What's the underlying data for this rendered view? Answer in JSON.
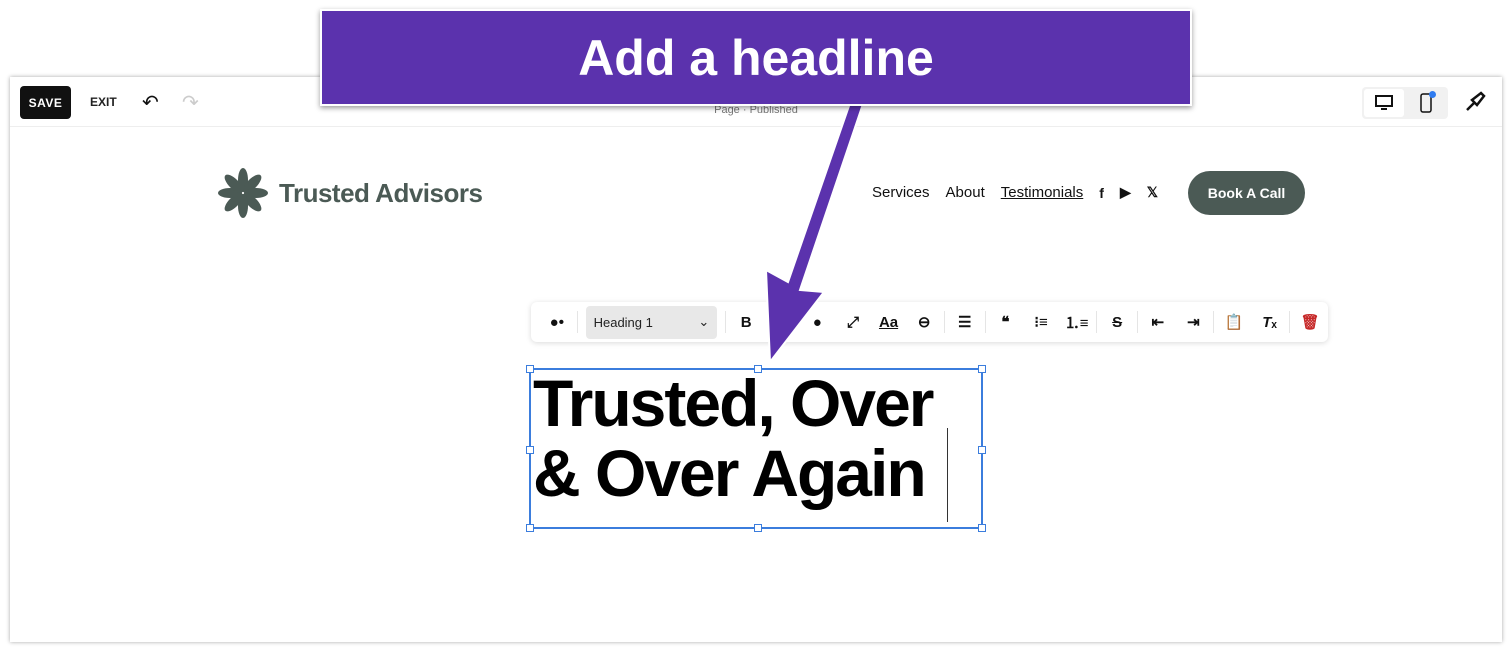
{
  "topbar": {
    "save": "SAVE",
    "exit": "EXIT",
    "status": "Page · Published"
  },
  "site": {
    "logo": "Trusted Advisors",
    "nav": [
      "Services",
      "About",
      "Testimonials"
    ],
    "cta": "Book A Call",
    "brand_color": "#4b5a55"
  },
  "toolbar": {
    "style_select": "Heading 1",
    "bold": "B"
  },
  "heading": {
    "line1": "Trusted, Over",
    "line2": "& Over Again"
  },
  "banner": {
    "text": "Add a headline",
    "color": "#5b32ad"
  }
}
